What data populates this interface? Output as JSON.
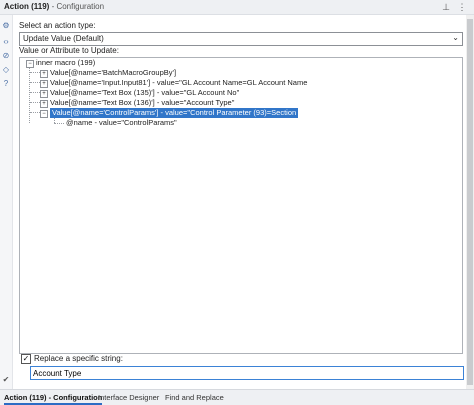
{
  "header": {
    "title_bold": "Action (119)",
    "title_sub": " - Configuration"
  },
  "content": {
    "action_type_label": "Select an action type:",
    "action_type_value": "Update Value (Default)",
    "value_label": "Value or Attribute to Update:",
    "tree": {
      "root": "inner macro (199)",
      "items": [
        "Value[@name='BatchMacroGroupBy']",
        "Value[@name='Input.Input81'] - value=\"GL Account Name=GL Account Name",
        "Value[@name='Text Box (135)'] - value=\"GL Account No\"",
        "Value[@name='Text Box (136)'] - value=\"Account Type\"",
        "Value[@name='ControlParams'] - value=\"Control Parameter (93)=Section"
      ],
      "child": "@name - value=\"ControlParams\""
    },
    "replace_label": "Replace a specific string:",
    "replace_value": "Account Type"
  },
  "tabs": [
    "Action (119) - Configuration",
    "Interface Designer",
    "Find and Replace"
  ],
  "colors": {
    "accent": "#3176c9",
    "selection": "#3176c9"
  }
}
